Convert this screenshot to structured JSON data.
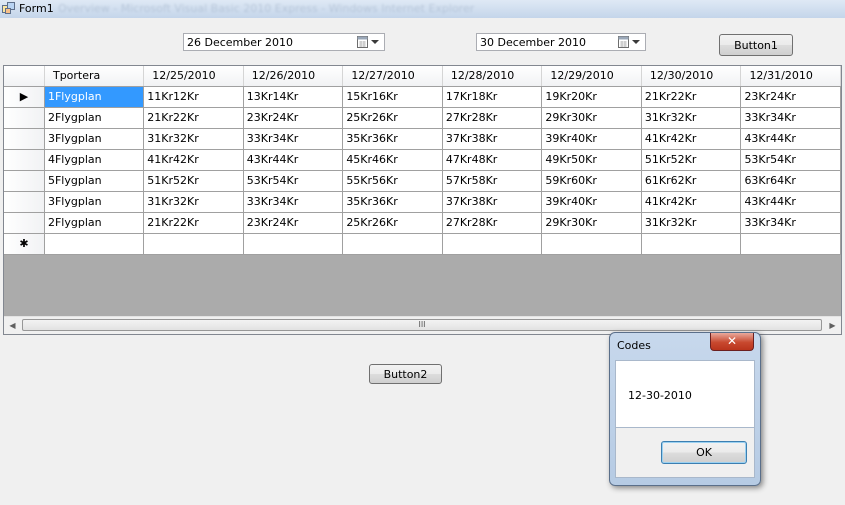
{
  "window": {
    "title": "Form1",
    "ghost_title": "Overview - Microsoft Visual Basic 2010 Express - Windows Internet Explorer"
  },
  "date_from": {
    "value": "26 December 2010"
  },
  "date_to": {
    "value": "30 December 2010"
  },
  "button1": {
    "label": "Button1"
  },
  "button2": {
    "label": "Button2"
  },
  "grid": {
    "columns": [
      "Tportera",
      "12/25/2010",
      "12/26/2010",
      "12/27/2010",
      "12/28/2010",
      "12/29/2010",
      "12/30/2010",
      "12/31/2010"
    ],
    "rows": [
      [
        "1Flygplan",
        "11Kr12Kr",
        "13Kr14Kr",
        "15Kr16Kr",
        "17Kr18Kr",
        "19Kr20Kr",
        "21Kr22Kr",
        "23Kr24Kr"
      ],
      [
        "2Flygplan",
        "21Kr22Kr",
        "23Kr24Kr",
        "25Kr26Kr",
        "27Kr28Kr",
        "29Kr30Kr",
        "31Kr32Kr",
        "33Kr34Kr"
      ],
      [
        "3Flygplan",
        "31Kr32Kr",
        "33Kr34Kr",
        "35Kr36Kr",
        "37Kr38Kr",
        "39Kr40Kr",
        "41Kr42Kr",
        "43Kr44Kr"
      ],
      [
        "4Flygplan",
        "41Kr42Kr",
        "43Kr44Kr",
        "45Kr46Kr",
        "47Kr48Kr",
        "49Kr50Kr",
        "51Kr52Kr",
        "53Kr54Kr"
      ],
      [
        "5Flygplan",
        "51Kr52Kr",
        "53Kr54Kr",
        "55Kr56Kr",
        "57Kr58Kr",
        "59Kr60Kr",
        "61Kr62Kr",
        "63Kr64Kr"
      ],
      [
        "3Flygplan",
        "31Kr32Kr",
        "33Kr34Kr",
        "35Kr36Kr",
        "37Kr38Kr",
        "39Kr40Kr",
        "41Kr42Kr",
        "43Kr44Kr"
      ],
      [
        "2Flygplan",
        "21Kr22Kr",
        "23Kr24Kr",
        "25Kr26Kr",
        "27Kr28Kr",
        "29Kr30Kr",
        "31Kr32Kr",
        "33Kr34Kr"
      ]
    ],
    "current_row_marker": "▶",
    "new_row_marker": "✱",
    "scroll_grip": "III"
  },
  "dialog": {
    "title": "Codes",
    "close_glyph": "✕",
    "message": "12-30-2010",
    "ok_label": "OK"
  }
}
